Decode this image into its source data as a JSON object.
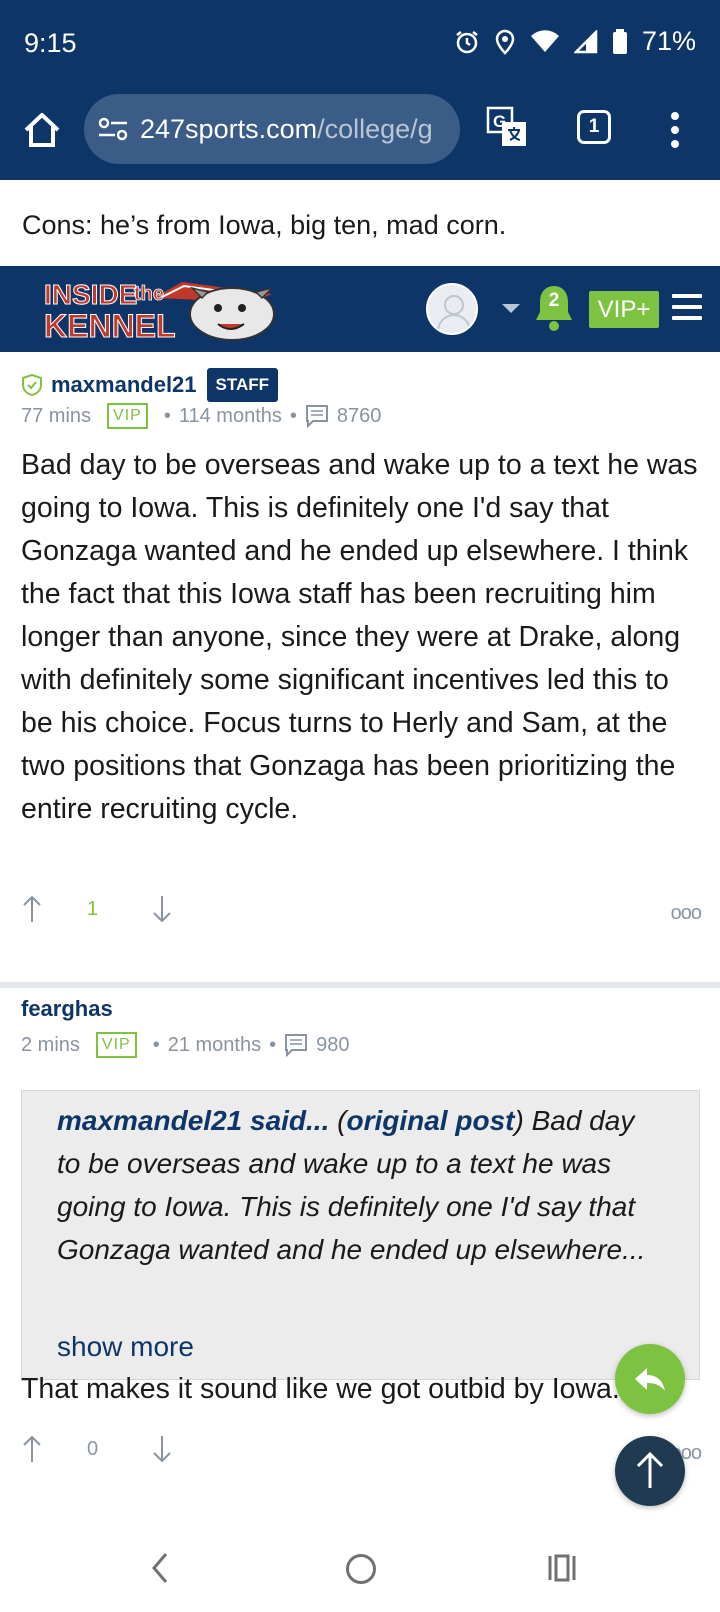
{
  "status_bar": {
    "time": "9:15",
    "battery": "71%",
    "icons": [
      "alarm-icon",
      "location-icon",
      "wifi-icon",
      "signal-icon",
      "battery-icon"
    ]
  },
  "browser": {
    "url_host": "247sports.com",
    "url_path": "/college/g",
    "tab_count": "1"
  },
  "page": {
    "cons_text": "Cons: he’s from Iowa, big ten, mad corn."
  },
  "site_header": {
    "logo_text_1": "INSIDE",
    "logo_text_2": "the",
    "logo_text_3": "KENNEL",
    "notification_count": "2",
    "vip_plus_label": "VIP+"
  },
  "posts": [
    {
      "author": "maxmandel21",
      "badge": "STAFF",
      "time": "77 mins",
      "vip_label": "VIP",
      "membership": "114 months",
      "post_count": "8760",
      "body": "Bad day to be overseas and wake up to a text he was going to Iowa. This is definitely one I'd say that Gonzaga wanted and he ended up elsewhere. I think the fact that this Iowa staff has been recruiting him longer than anyone, since they were at Drake, along with definitely some significant incentives led this to be his choice. Focus turns to Herly and Sam, at the two positions that Gonzaga has been prioritizing the entire recruiting cycle.",
      "score": "1",
      "more_label": "ooo"
    },
    {
      "author": "fearghas",
      "time": "2 mins",
      "vip_label": "VIP",
      "membership": "21 months",
      "post_count": "980",
      "quote": {
        "author": "maxmandel21 said...",
        "open_paren": " (",
        "link": "original post",
        "close_paren": ")",
        "text": " Bad day to be overseas and wake up to a text he was going to Iowa. This is definitely one I'd say that Gonzaga wanted and he ended up elsewhere...",
        "show_more": "show more"
      },
      "body": "That makes it sound like we got outbid by Iowa.",
      "score": "0",
      "more_label": "ooo"
    }
  ],
  "colors": {
    "navy": "#0e3567",
    "green": "#7ec242",
    "muted": "#8a94a0"
  }
}
